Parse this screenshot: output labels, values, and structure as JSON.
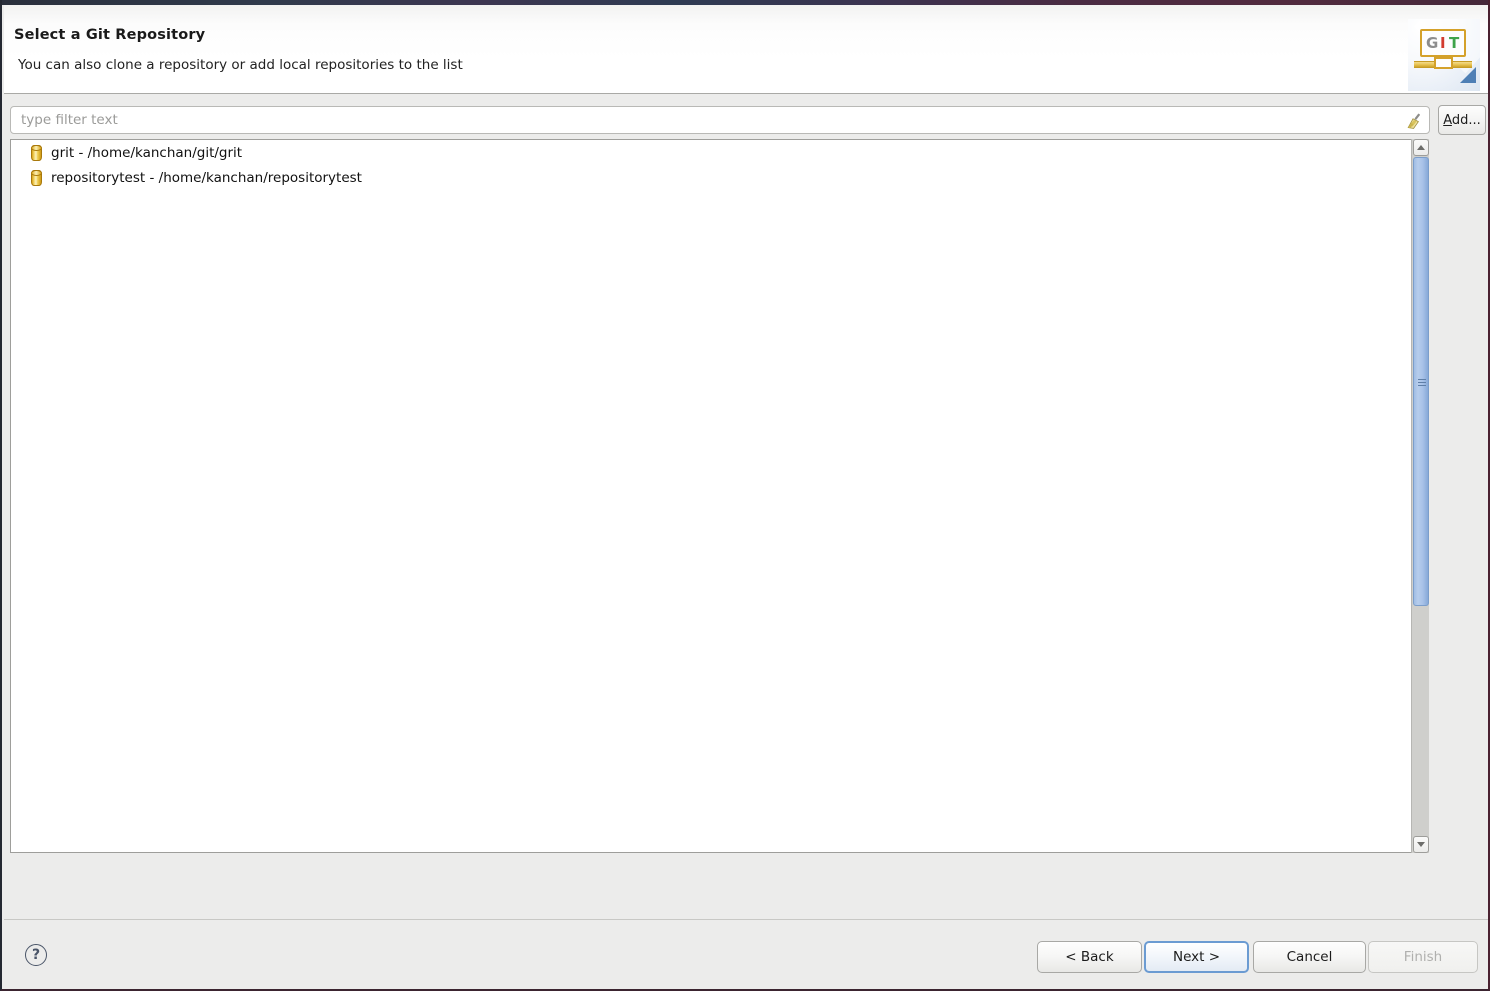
{
  "dialog": {
    "title": "Select a Git Repository",
    "subtitle": "You can also clone a repository or add local repositories to the list",
    "banner_logo": {
      "letters": [
        "G",
        "I",
        "T"
      ],
      "colors": {
        "g": "#8c8c8c",
        "i": "#d23b2e",
        "t": "#3fa34a",
        "frame": "#d4a12a"
      }
    }
  },
  "filter": {
    "placeholder": "type filter text",
    "value": "",
    "clear_icon": "broom-icon",
    "add_label": "Add...",
    "add_mnemonic": "A"
  },
  "repositories": [
    {
      "name": "grit",
      "path": "/home/kanchan/git/grit",
      "label": "grit - /home/kanchan/git/grit",
      "icon": "repository-cylinder-icon"
    },
    {
      "name": "repositorytest",
      "path": "/home/kanchan/repositorytest",
      "label": "repositorytest - /home/kanchan/repositorytest",
      "icon": "repository-cylinder-icon"
    }
  ],
  "scrollbar": {
    "up_icon": "chevron-up-icon",
    "down_icon": "chevron-down-icon",
    "thumb_color": "#a8c2e8",
    "track_color": "#cfcfcc"
  },
  "footer": {
    "help_glyph": "?",
    "buttons": [
      {
        "id": "back",
        "label": "< Back",
        "enabled": true,
        "focused": false
      },
      {
        "id": "next",
        "label": "Next >",
        "enabled": true,
        "focused": true
      },
      {
        "id": "cancel",
        "label": "Cancel",
        "enabled": true,
        "focused": false
      },
      {
        "id": "finish",
        "label": "Finish",
        "enabled": false,
        "focused": false
      }
    ]
  }
}
